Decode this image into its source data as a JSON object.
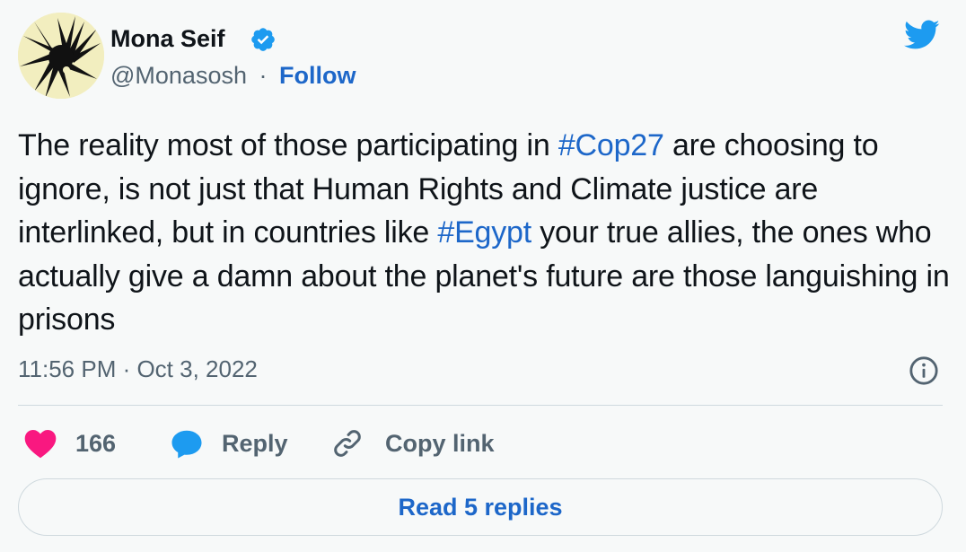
{
  "author": {
    "name": "Mona Seif",
    "handle": "@Monasosh",
    "separator": "·",
    "follow_label": "Follow",
    "verified": true
  },
  "tweet": {
    "segments": [
      {
        "text": "The reality most of those participating in ",
        "type": "text"
      },
      {
        "text": "#Cop27",
        "type": "hashtag"
      },
      {
        "text": " are choosing to ignore, is not just that Human Rights and Climate justice are interlinked, but in countries like ",
        "type": "text"
      },
      {
        "text": "#Egypt",
        "type": "hashtag"
      },
      {
        "text": " your true allies, the ones who actually give a damn about the planet's future are those languishing in prisons",
        "type": "text"
      }
    ],
    "timestamp": "11:56 PM · Oct 3, 2022"
  },
  "actions": {
    "like_count": "166",
    "reply_label": "Reply",
    "copy_link_label": "Copy link"
  },
  "read_replies_label": "Read 5 replies",
  "icons": {
    "verified": "verified-badge-icon",
    "brand": "twitter-bird-icon",
    "info": "info-icon",
    "like": "heart-icon",
    "reply": "speech-bubble-icon",
    "copy": "link-icon"
  },
  "colors": {
    "accent": "#1d9bf0",
    "link": "#1d67c9",
    "like": "#f91880",
    "text": "#0f1419",
    "muted": "#536471",
    "background": "#f7f9f9",
    "avatar_bg": "#f2eebf"
  }
}
